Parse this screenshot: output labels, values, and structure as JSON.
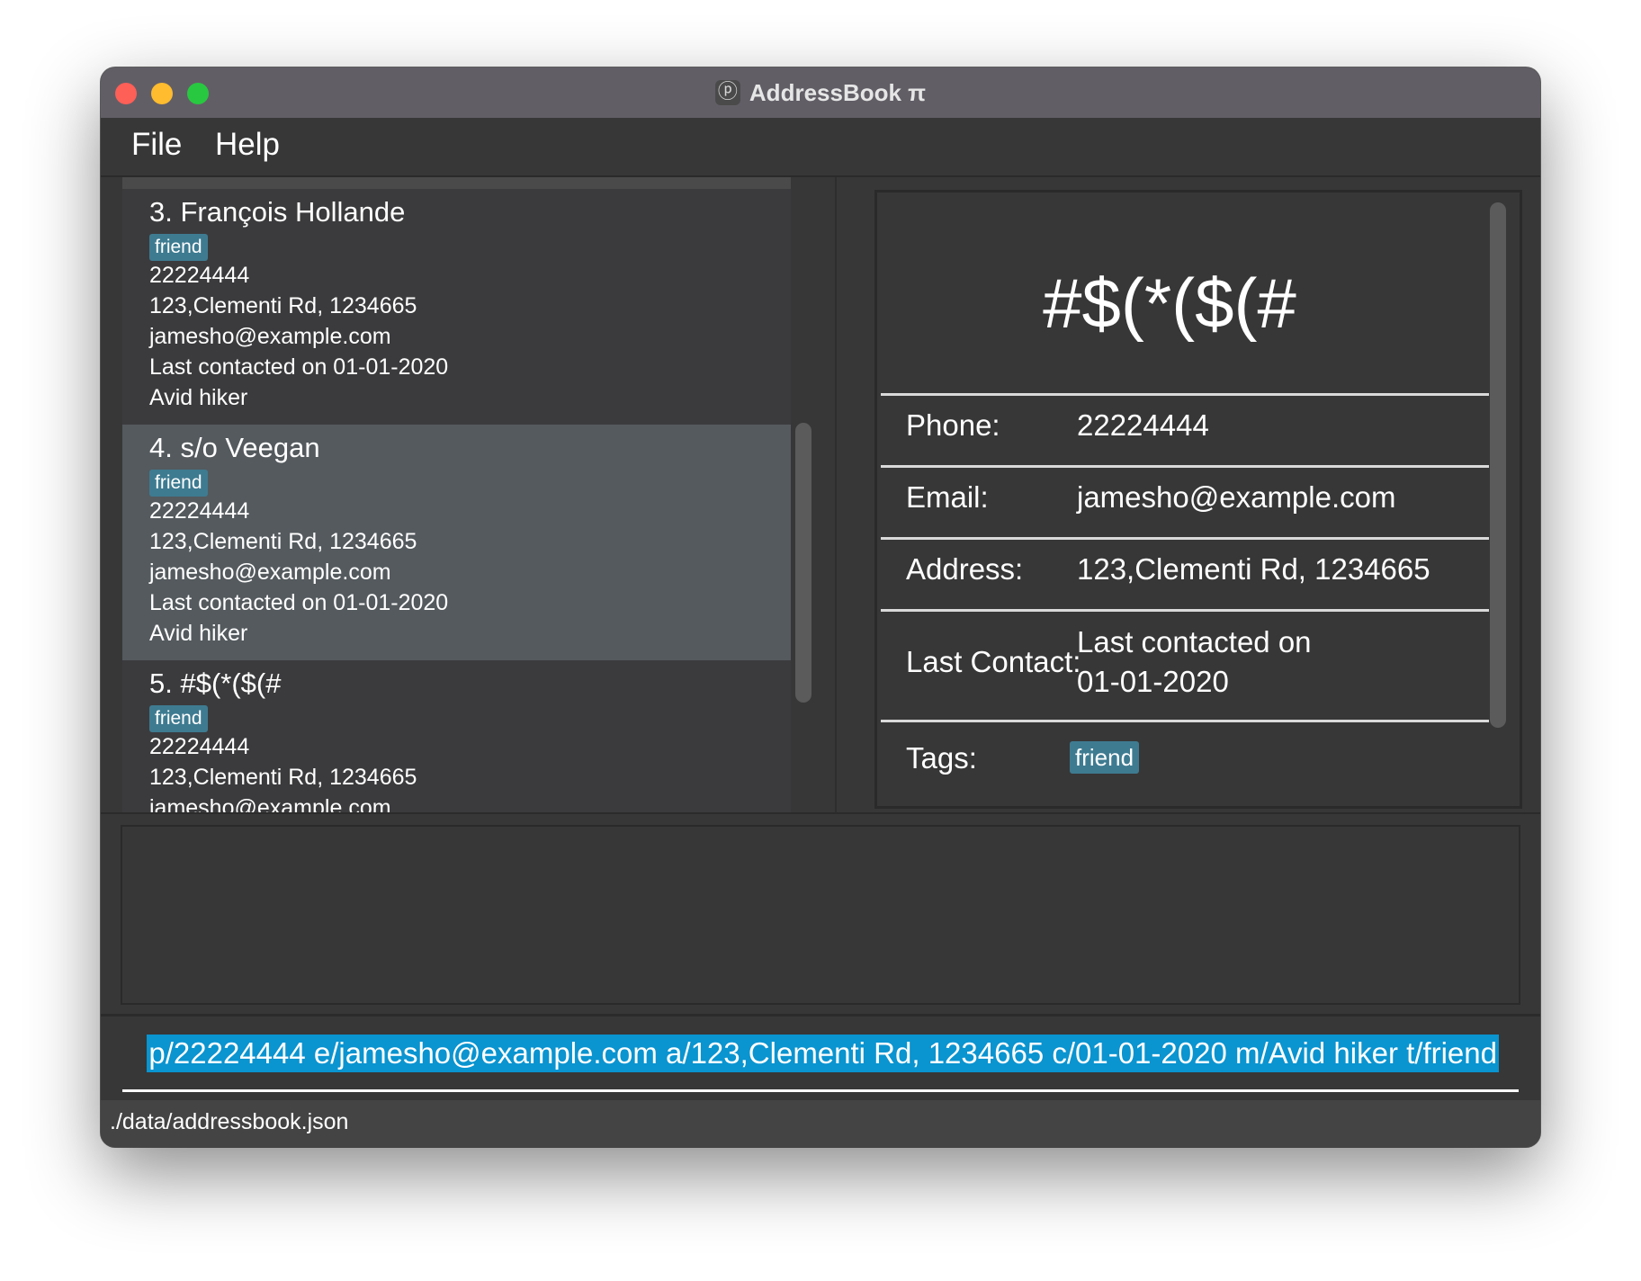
{
  "window": {
    "title": "AddressBook π",
    "app_icon_glyph": "ⓟ",
    "app_icon_name": "app-logo-icon"
  },
  "menu": {
    "file": "File",
    "help": "Help"
  },
  "persons": [
    {
      "name": "3.  François Hollande",
      "tag": "friend",
      "phone": "22224444",
      "address": "123,Clementi Rd, 1234665",
      "email": "jamesho@example.com",
      "last_contact": "Last contacted on 01-01-2020",
      "remark": "Avid hiker"
    },
    {
      "name": "4.  s/o Veegan",
      "tag": "friend",
      "phone": "22224444",
      "address": "123,Clementi Rd, 1234665",
      "email": "jamesho@example.com",
      "last_contact": "Last contacted on 01-01-2020",
      "remark": "Avid hiker"
    },
    {
      "name": "5.  #$(*($(#",
      "tag": "friend",
      "phone": "22224444",
      "address": "123,Clementi Rd, 1234665",
      "email": "jamesho@example.com"
    }
  ],
  "detail": {
    "name": "#$(*($(#",
    "phone_label": "Phone:",
    "phone": "22224444",
    "email_label": "Email:",
    "email": "jamesho@example.com",
    "address_label": "Address:",
    "address": "123,Clementi Rd, 1234665",
    "last_contact_label": "Last Contact:",
    "last_contact_line1": "Last contacted on",
    "last_contact_line2": "01-01-2020",
    "tags_label": "Tags:",
    "tag": "friend"
  },
  "result_display": "",
  "command_box": {
    "value": "p/22224444 e/jamesho@example.com a/123,Clementi Rd, 1234665 c/01-01-2020 m/Avid hiker t/friend"
  },
  "status_bar": {
    "file_path": "./data/addressbook.json"
  },
  "colors": {
    "tag_bg": "#3e7b91",
    "selection_bg": "#0a94d0",
    "selected_card": "#545a5e",
    "window_bg": "#373737"
  }
}
